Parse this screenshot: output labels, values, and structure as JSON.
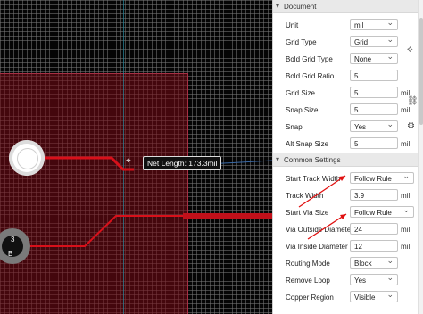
{
  "canvas": {
    "tooltip": "Net Length: 173.3mil",
    "pad_label": "B",
    "pad_label_top": "3"
  },
  "sections": {
    "document_title": "Document",
    "common_title": "Common Settings"
  },
  "document": [
    {
      "label": "Unit",
      "value": "mil",
      "kind": "select"
    },
    {
      "label": "Grid Type",
      "value": "Grid",
      "kind": "select"
    },
    {
      "label": "Bold Grid Type",
      "value": "None",
      "kind": "select"
    },
    {
      "label": "Bold Grid Ratio",
      "value": "5",
      "kind": "input"
    },
    {
      "label": "Grid Size",
      "value": "5",
      "kind": "input",
      "unit": "mil"
    },
    {
      "label": "Snap Size",
      "value": "5",
      "kind": "input",
      "unit": "mil"
    },
    {
      "label": "Snap",
      "value": "Yes",
      "kind": "select"
    },
    {
      "label": "Alt Snap Size",
      "value": "5",
      "kind": "input",
      "unit": "mil"
    }
  ],
  "common": [
    {
      "label": "Start Track Width",
      "value": "Follow Rule",
      "kind": "select"
    },
    {
      "label": "Track Width",
      "value": "3.9",
      "kind": "input",
      "unit": "mil"
    },
    {
      "label": "Start Via Size",
      "value": "Follow Rule",
      "kind": "select"
    },
    {
      "label": "Via Outside Diameter",
      "value": "24",
      "kind": "input",
      "unit": "mil"
    },
    {
      "label": "Via Inside Diameter",
      "value": "12",
      "kind": "input",
      "unit": "mil"
    },
    {
      "label": "Routing Mode",
      "value": "Block",
      "kind": "select"
    },
    {
      "label": "Remove Loop",
      "value": "Yes",
      "kind": "select"
    },
    {
      "label": "Copper Region",
      "value": "Visible",
      "kind": "select"
    }
  ],
  "icons": {
    "collapse": "chevron-down-icon",
    "grid_settings": "grid-adjust-icon",
    "link": "link-icon",
    "snap_settings": "gear-icon"
  },
  "colors": {
    "track": "#d8101a",
    "copper_region": "#7a0a14",
    "arrow": "#e01010"
  }
}
